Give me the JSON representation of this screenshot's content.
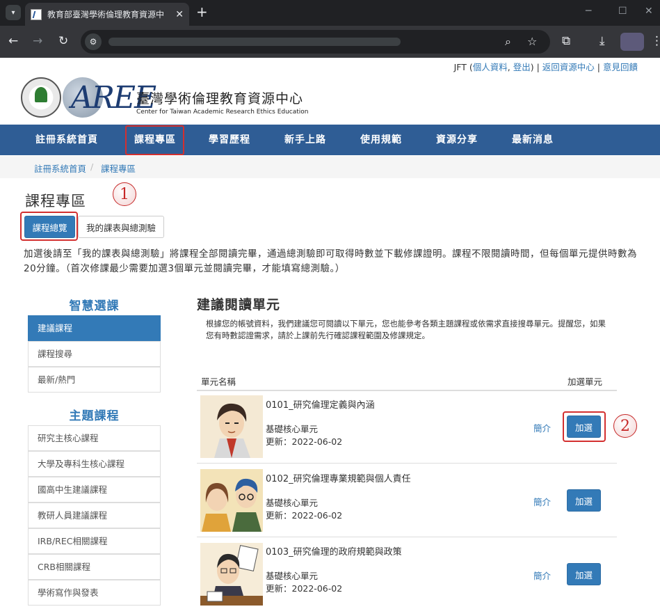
{
  "browser": {
    "tab_title": "教育部臺灣學術倫理教育資源中",
    "tab_close": "✕",
    "new_tab": "+",
    "menu_glyph": "▾"
  },
  "header": {
    "user_name": "JFT",
    "user_links_open": "(",
    "profile_link": "個人資料",
    "comma": ", ",
    "logout_link": "登出",
    "user_links_close": ")",
    "divider": " | ",
    "back_link": "返回資源中心",
    "feedback_link": "意見回饋",
    "logo_mark": "AREE",
    "logo_cn": "臺灣學術倫理教育資源中心",
    "logo_en": "Center for Taiwan Academic Research Ethics Education"
  },
  "nav": {
    "items": [
      "註冊系統首頁",
      "課程專區",
      "學習歷程",
      "新手上路",
      "使用規範",
      "資源分享",
      "最新消息"
    ]
  },
  "breadcrumb": {
    "items": [
      "註冊系統首頁",
      "課程專區"
    ],
    "separator": "/"
  },
  "page": {
    "title": "課程專區",
    "tab_overview": "課程總覽",
    "tab_my_courses": "我的課表與總測驗",
    "intro": "加選後請至「我的課表與總測驗」將課程全部閱讀完畢，通過總測驗即可取得時數並下載修課證明。課程不限閱讀時間，但每個單元提供時數為20分鐘。（首次修課最少需要加選3個單元並閱讀完畢，才能填寫總測驗。）"
  },
  "annotations": {
    "marker_1": "1",
    "marker_2": "2"
  },
  "sidebar": {
    "smart_heading": "智慧選課",
    "smart_items": [
      "建議課程",
      "課程搜尋",
      "最新/熱門"
    ],
    "topic_heading": "主題課程",
    "topic_items": [
      "研究主核心課程",
      "大學及專科生核心課程",
      "國高中生建議課程",
      "教研人員建議課程",
      "IRB/REC相關課程",
      "CRB相關課程",
      "學術寫作與發表"
    ]
  },
  "main": {
    "title": "建議閱讀單元",
    "description": "根據您的帳號資料，我們建議您可閱讀以下單元，您也能參考各類主題課程或依需求直接搜尋單元。提醒您，如果您有時數認證需求，請於上課前先行確認課程範圍及修課規定。",
    "col_name": "單元名稱",
    "col_add": "加選單元",
    "courses": [
      {
        "name": "0101_研究倫理定義與內涵",
        "type": "基礎核心單元",
        "updated": "更新：2022-06-02",
        "intro_label": "簡介",
        "add_label": "加選"
      },
      {
        "name": "0102_研究倫理專業規範與個人責任",
        "type": "基礎核心單元",
        "updated": "更新：2022-06-02",
        "intro_label": "簡介",
        "add_label": "加選"
      },
      {
        "name": "0103_研究倫理的政府規範與政策",
        "type": "基礎核心單元",
        "updated": "更新：2022-06-02",
        "intro_label": "簡介",
        "add_label": "加選"
      }
    ]
  }
}
